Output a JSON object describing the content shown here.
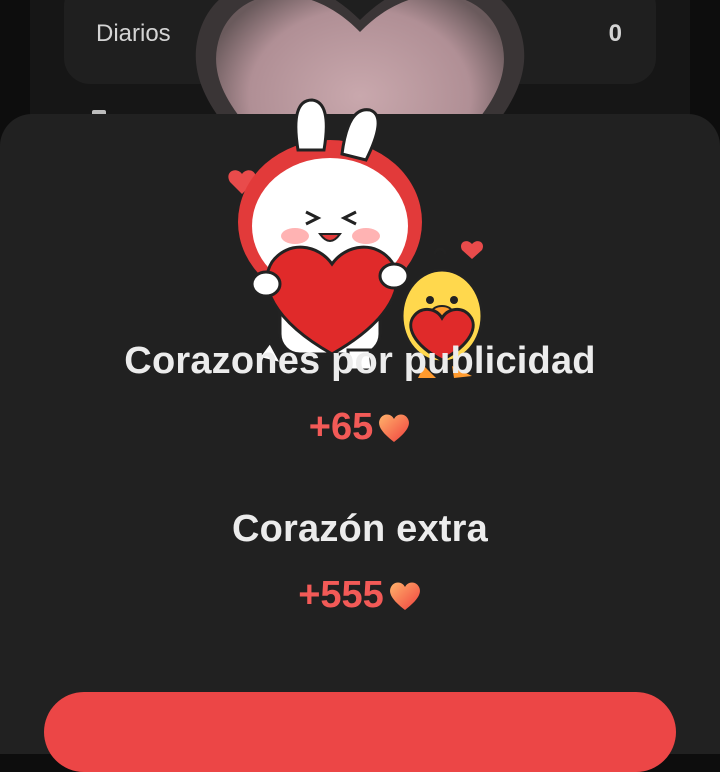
{
  "stats": {
    "label": "Diarios",
    "value": "0"
  },
  "rewards": [
    {
      "title": "Corazones por publicidad",
      "amount": "+65"
    },
    {
      "title": "Corazón extra",
      "amount": "+555"
    }
  ],
  "colors": {
    "accent": "#ec4646",
    "amount": "#f25a57",
    "sheet": "#212121",
    "background": "#0d0d0d"
  },
  "icons": {
    "amount": "heart-icon",
    "illustration": "bunny-and-chick-holding-hearts"
  }
}
